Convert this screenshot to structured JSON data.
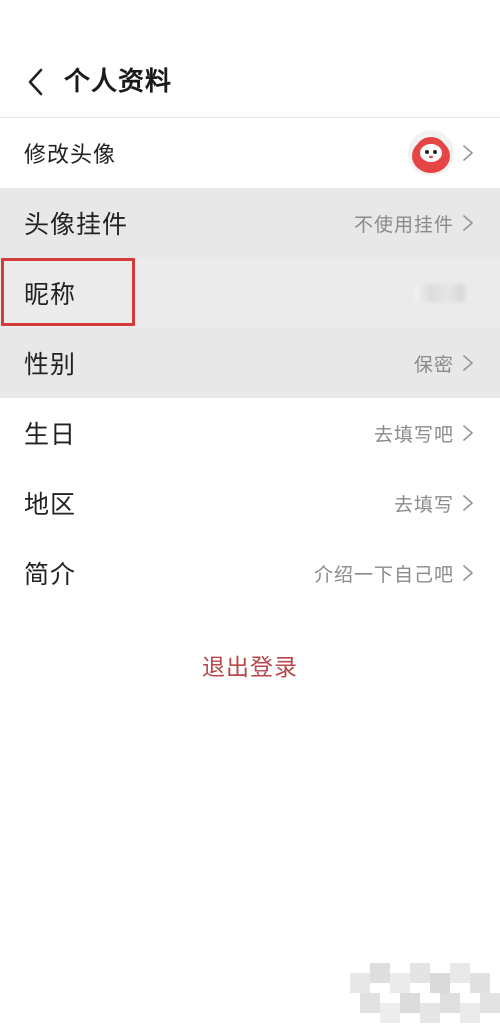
{
  "header": {
    "title": "个人资料"
  },
  "rows": [
    {
      "label": "修改头像",
      "value": "",
      "kind": "avatar"
    },
    {
      "label": "头像挂件",
      "value": "不使用挂件",
      "kind": "text"
    },
    {
      "label": "昵称",
      "value": "",
      "kind": "blurred"
    },
    {
      "label": "性别",
      "value": "保密",
      "kind": "text"
    },
    {
      "label": "生日",
      "value": "去填写吧",
      "kind": "text"
    },
    {
      "label": "地区",
      "value": "去填写",
      "kind": "text"
    },
    {
      "label": "简介",
      "value": "介绍一下自己吧",
      "kind": "text"
    }
  ],
  "logout_label": "退出登录",
  "colors": {
    "accent_red": "#d63b3b",
    "logout_text": "#b8474a",
    "row_shaded": "#e8e8e8",
    "value_gray": "#8a8a8a"
  },
  "icons": {
    "back": "chevron-left-icon",
    "row_arrow": "chevron-right-icon",
    "avatar": "mascot-avatar-icon"
  }
}
